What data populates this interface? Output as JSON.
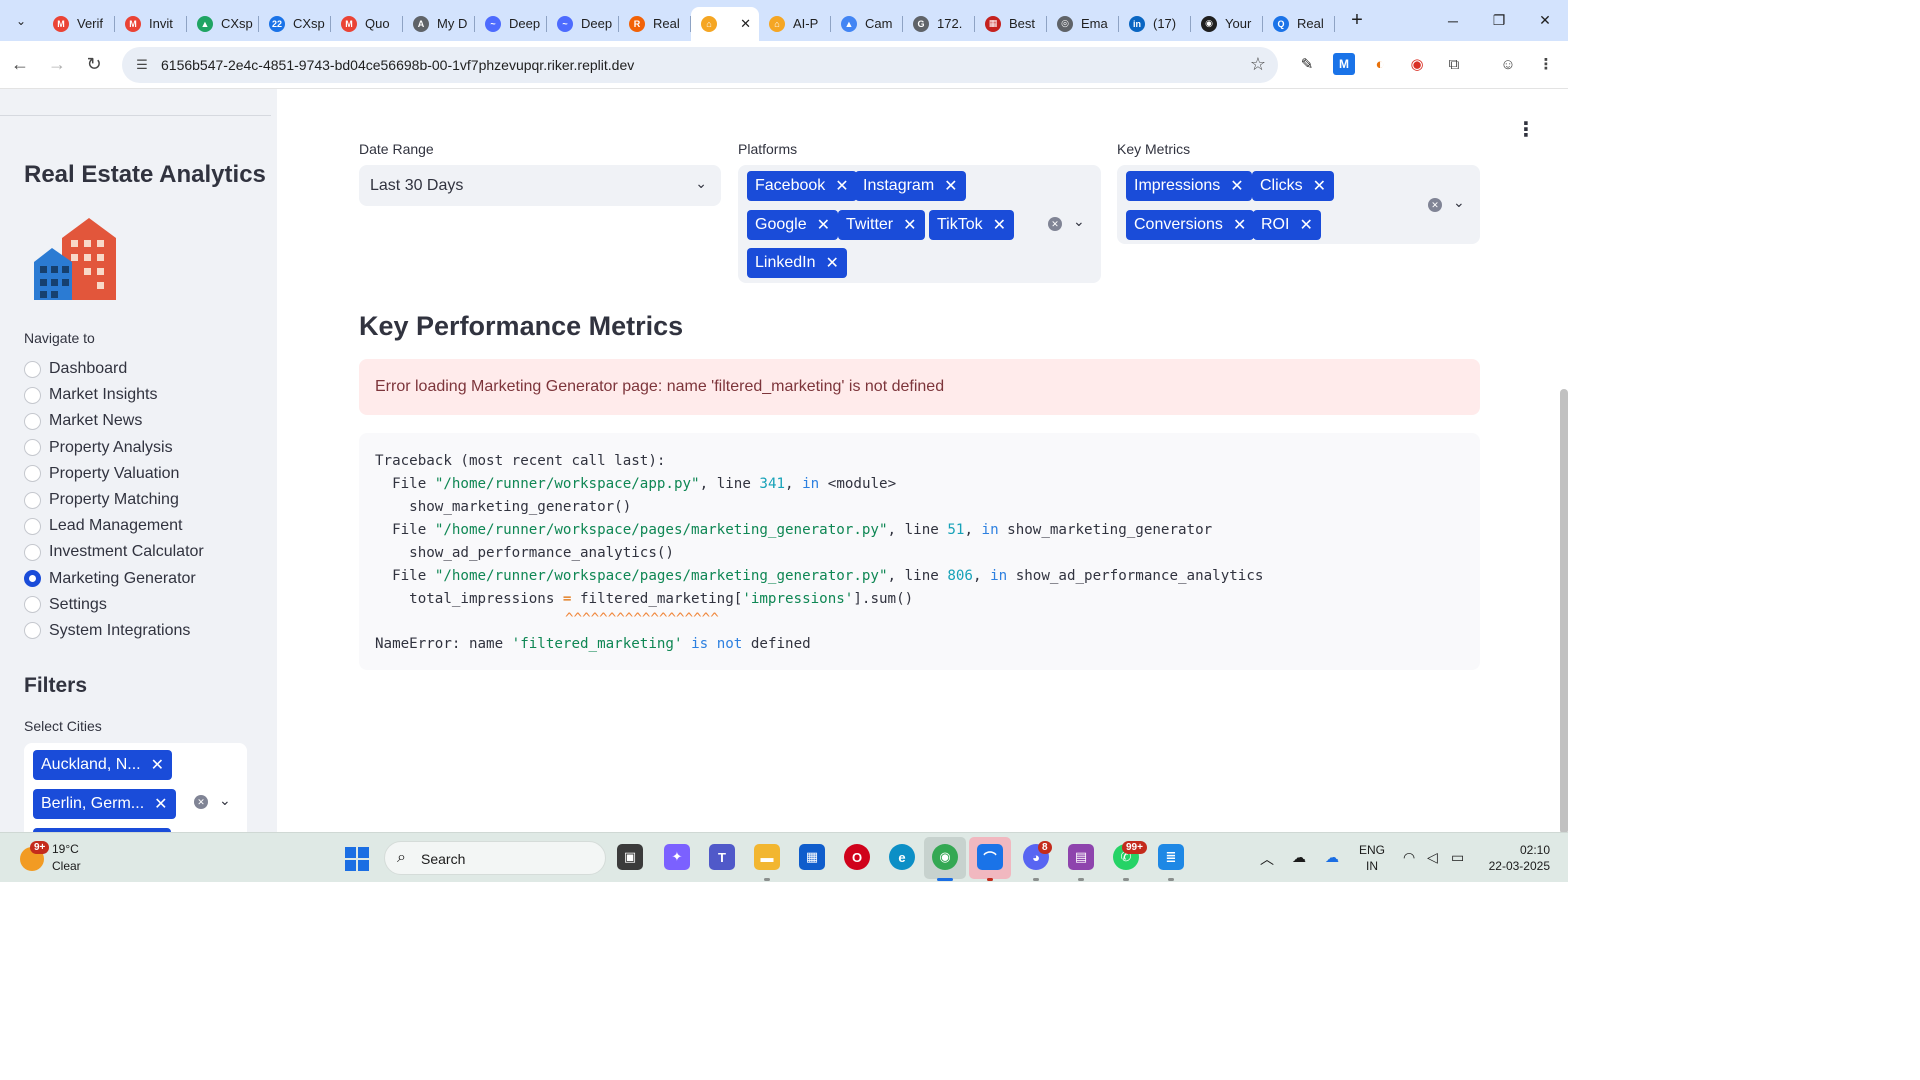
{
  "browser": {
    "tabs": [
      {
        "label": "Verif",
        "color": "#ea4335",
        "glyph": "M"
      },
      {
        "label": "Invit",
        "color": "#ea4335",
        "glyph": "M"
      },
      {
        "label": "CXsp",
        "color": "#1fa463",
        "glyph": "▲"
      },
      {
        "label": "CXsp",
        "color": "#1a73e8",
        "glyph": "22"
      },
      {
        "label": "Quo",
        "color": "#ea4335",
        "glyph": "M"
      },
      {
        "label": "My D",
        "color": "#5f6368",
        "glyph": "A"
      },
      {
        "label": "Deep",
        "color": "#4d6bfe",
        "glyph": "~"
      },
      {
        "label": "Deep",
        "color": "#4d6bfe",
        "glyph": "~"
      },
      {
        "label": "Real",
        "color": "#f26207",
        "glyph": "R"
      },
      {
        "label": "",
        "color": "#f5a623",
        "glyph": "⌂",
        "active": true
      },
      {
        "label": "AI-P",
        "color": "#f5a623",
        "glyph": "⌂"
      },
      {
        "label": "Cam",
        "color": "#4285f4",
        "glyph": "▲"
      },
      {
        "label": "172.",
        "color": "#5f6368",
        "glyph": "G"
      },
      {
        "label": "Best",
        "color": "#c5221f",
        "glyph": "▦"
      },
      {
        "label": "Ema",
        "color": "#5f6368",
        "glyph": "◎"
      },
      {
        "label": "(17)",
        "color": "#0a66c2",
        "glyph": "in"
      },
      {
        "label": "Your",
        "color": "#1f1f1f",
        "glyph": "◉"
      },
      {
        "label": "Real",
        "color": "#1a73e8",
        "glyph": "Q"
      }
    ],
    "url": "6156b547-2e4c-4851-9743-bd04ce56698b-00-1vf7phzevupqr.riker.replit.dev"
  },
  "sidebar": {
    "title": "Real Estate Analytics",
    "nav_label": "Navigate to",
    "nav_items": [
      {
        "label": "Dashboard",
        "checked": false
      },
      {
        "label": "Market Insights",
        "checked": false
      },
      {
        "label": "Market News",
        "checked": false
      },
      {
        "label": "Property Analysis",
        "checked": false
      },
      {
        "label": "Property Valuation",
        "checked": false
      },
      {
        "label": "Property Matching",
        "checked": false
      },
      {
        "label": "Lead Management",
        "checked": false
      },
      {
        "label": "Investment Calculator",
        "checked": false
      },
      {
        "label": "Marketing Generator",
        "checked": true
      },
      {
        "label": "Settings",
        "checked": false
      },
      {
        "label": "System Integrations",
        "checked": false
      }
    ],
    "filters_title": "Filters",
    "cities_label": "Select Cities",
    "cities": [
      "Auckland, N...",
      "Berlin, Germ..."
    ]
  },
  "main": {
    "date_range": {
      "label": "Date Range",
      "value": "Last 30 Days"
    },
    "platforms": {
      "label": "Platforms",
      "chips": [
        "Facebook",
        "Instagram",
        "Google",
        "Twitter",
        "TikTok",
        "LinkedIn"
      ]
    },
    "key_metrics": {
      "label": "Key Metrics",
      "chips": [
        "Impressions",
        "Clicks",
        "Conversions",
        "ROI"
      ]
    },
    "section_title": "Key Performance Metrics",
    "error_message": "Error loading Marketing Generator page: name 'filtered_marketing' is not defined",
    "traceback": {
      "header": "Traceback (most recent call last):",
      "file_kw": "File",
      "line_kw": "line",
      "in_kw": "in",
      "frames": [
        {
          "path": "\"/home/runner/workspace/app.py\"",
          "line": "341",
          "func": "<module>",
          "code": "show_marketing_generator()"
        },
        {
          "path": "\"/home/runner/workspace/pages/marketing_generator.py\"",
          "line": "51",
          "func": "show_marketing_generator",
          "code": "show_ad_performance_analytics()"
        },
        {
          "path": "\"/home/runner/workspace/pages/marketing_generator.py\"",
          "line": "806",
          "func": "show_ad_performance_analytics",
          "code_prefix": "total_impressions ",
          "code_op": "=",
          "code_mid": " filtered_marketing[",
          "code_str": "'impressions'",
          "code_suffix": "].sum()"
        }
      ],
      "carets": "^^^^^^^^^^^^^^^^^^",
      "error_name": "NameError: name ",
      "error_str": "'filtered_marketing'",
      "error_is": "is",
      "error_not": "not",
      "error_tail": " defined"
    }
  },
  "taskbar": {
    "weather_badge": "9+",
    "temperature": "19°C",
    "condition": "Clear",
    "search_placeholder": "Search",
    "discord_badge": "8",
    "whatsapp_badge": "99+",
    "lang_top": "ENG",
    "lang_bottom": "IN",
    "time": "02:10",
    "date": "22-03-2025"
  }
}
